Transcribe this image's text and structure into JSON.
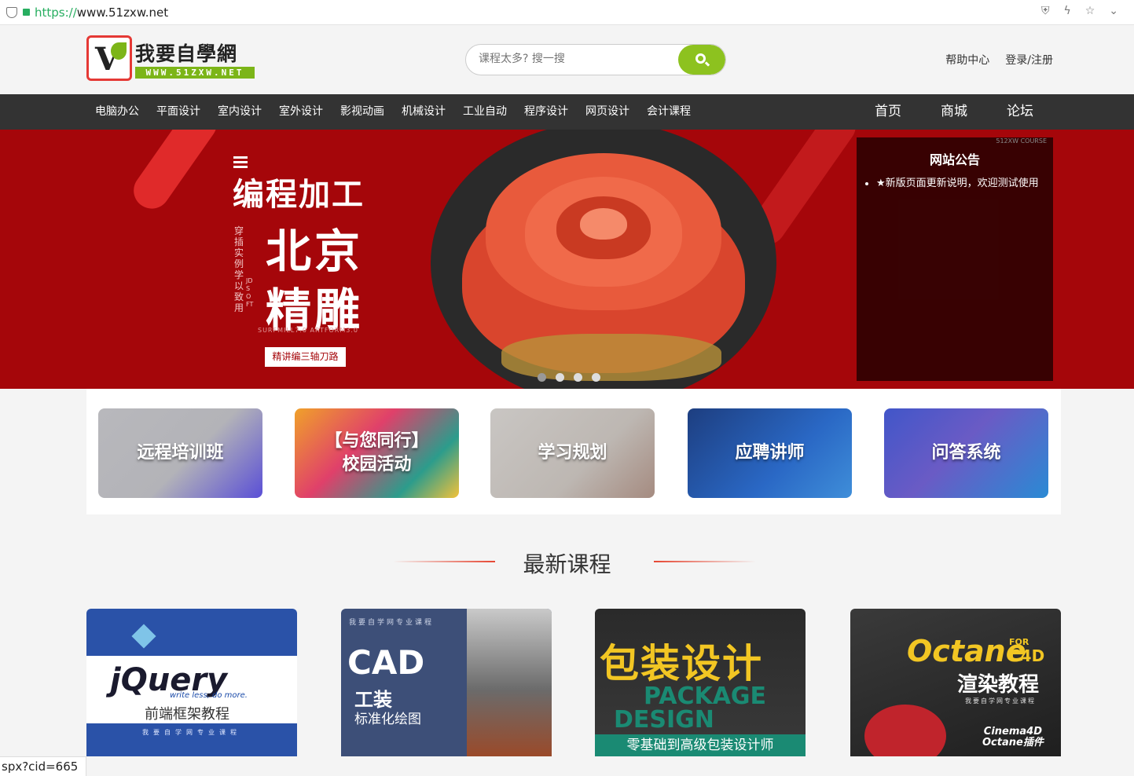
{
  "browser": {
    "url_scheme": "https://",
    "url_rest": "www.51zxw.net",
    "icons": [
      "shield-icon",
      "lightning-icon",
      "star-icon",
      "chevron-down-icon"
    ]
  },
  "header": {
    "logo_name": "我要自學網",
    "logo_sub": "WWW.51ZXW.NET",
    "search_placeholder": "课程太多? 搜一搜",
    "help": "帮助中心",
    "login": "登录/注册"
  },
  "nav": {
    "categories": [
      "电脑办公",
      "平面设计",
      "室内设计",
      "室外设计",
      "影视动画",
      "机械设计",
      "工业自动",
      "程序设计",
      "网页设计",
      "会计课程"
    ],
    "main": [
      "首页",
      "商城",
      "论坛"
    ]
  },
  "banner": {
    "title": "编程加工",
    "city": "北京",
    "craft": "精雕",
    "vert_text": "穿插实例 学以致用",
    "vert_text2": "JDSOFT",
    "soft": "SURFMILL7.0   ARTFORM3.0",
    "button": "精讲编三轴刀路",
    "slide_count": 4,
    "active_slide": 0
  },
  "notice": {
    "title": "网站公告",
    "items": [
      "★新版页面更新说明，欢迎测试使用"
    ],
    "tag": "512XW COURSE"
  },
  "quick_links": [
    "远程培训班",
    "【与您同行】\n校园活动",
    "学习规划",
    "应聘讲师",
    "问答系统"
  ],
  "section": {
    "title": "最新课程"
  },
  "courses": [
    {
      "brand": "jQuery",
      "slogan": "write less, do more.",
      "name": "前端框架教程",
      "footer": "我要自学网专业课程"
    },
    {
      "header": "我要自学网专业课程",
      "brand": "CAD",
      "name1": "工装",
      "name2": "标准化绘图"
    },
    {
      "brand": "包装设计",
      "en1": "PACKAGE",
      "en2": "DESIGN",
      "tagline": "零基础到高级包装设计师"
    },
    {
      "brand": "Octane",
      "for": "FOR",
      "c4d": "C4D",
      "name": "渲染教程",
      "header": "我要自学网专业课程",
      "plugin1": "Cinema4D",
      "plugin2": "Octane插件"
    }
  ],
  "status_bar": "spx?cid=665"
}
